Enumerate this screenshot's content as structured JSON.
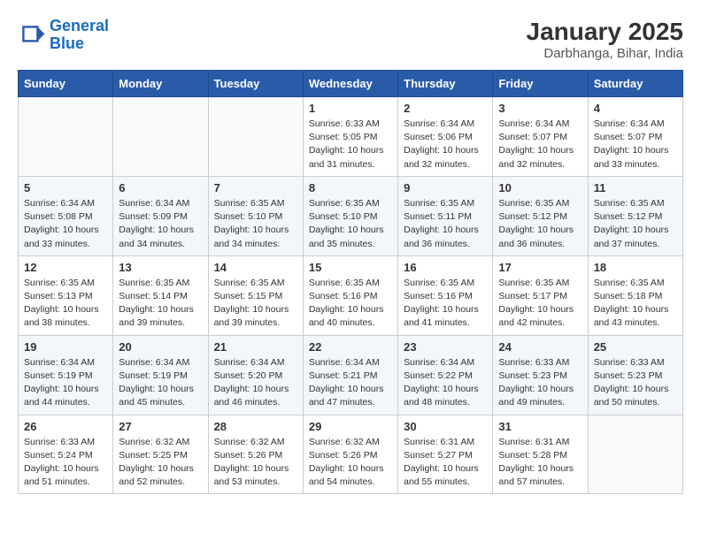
{
  "header": {
    "logo_line1": "General",
    "logo_line2": "Blue",
    "month": "January 2025",
    "location": "Darbhanga, Bihar, India"
  },
  "weekdays": [
    "Sunday",
    "Monday",
    "Tuesday",
    "Wednesday",
    "Thursday",
    "Friday",
    "Saturday"
  ],
  "weeks": [
    [
      {
        "day": "",
        "info": ""
      },
      {
        "day": "",
        "info": ""
      },
      {
        "day": "",
        "info": ""
      },
      {
        "day": "1",
        "info": "Sunrise: 6:33 AM\nSunset: 5:05 PM\nDaylight: 10 hours\nand 31 minutes."
      },
      {
        "day": "2",
        "info": "Sunrise: 6:34 AM\nSunset: 5:06 PM\nDaylight: 10 hours\nand 32 minutes."
      },
      {
        "day": "3",
        "info": "Sunrise: 6:34 AM\nSunset: 5:07 PM\nDaylight: 10 hours\nand 32 minutes."
      },
      {
        "day": "4",
        "info": "Sunrise: 6:34 AM\nSunset: 5:07 PM\nDaylight: 10 hours\nand 33 minutes."
      }
    ],
    [
      {
        "day": "5",
        "info": "Sunrise: 6:34 AM\nSunset: 5:08 PM\nDaylight: 10 hours\nand 33 minutes."
      },
      {
        "day": "6",
        "info": "Sunrise: 6:34 AM\nSunset: 5:09 PM\nDaylight: 10 hours\nand 34 minutes."
      },
      {
        "day": "7",
        "info": "Sunrise: 6:35 AM\nSunset: 5:10 PM\nDaylight: 10 hours\nand 34 minutes."
      },
      {
        "day": "8",
        "info": "Sunrise: 6:35 AM\nSunset: 5:10 PM\nDaylight: 10 hours\nand 35 minutes."
      },
      {
        "day": "9",
        "info": "Sunrise: 6:35 AM\nSunset: 5:11 PM\nDaylight: 10 hours\nand 36 minutes."
      },
      {
        "day": "10",
        "info": "Sunrise: 6:35 AM\nSunset: 5:12 PM\nDaylight: 10 hours\nand 36 minutes."
      },
      {
        "day": "11",
        "info": "Sunrise: 6:35 AM\nSunset: 5:12 PM\nDaylight: 10 hours\nand 37 minutes."
      }
    ],
    [
      {
        "day": "12",
        "info": "Sunrise: 6:35 AM\nSunset: 5:13 PM\nDaylight: 10 hours\nand 38 minutes."
      },
      {
        "day": "13",
        "info": "Sunrise: 6:35 AM\nSunset: 5:14 PM\nDaylight: 10 hours\nand 39 minutes."
      },
      {
        "day": "14",
        "info": "Sunrise: 6:35 AM\nSunset: 5:15 PM\nDaylight: 10 hours\nand 39 minutes."
      },
      {
        "day": "15",
        "info": "Sunrise: 6:35 AM\nSunset: 5:16 PM\nDaylight: 10 hours\nand 40 minutes."
      },
      {
        "day": "16",
        "info": "Sunrise: 6:35 AM\nSunset: 5:16 PM\nDaylight: 10 hours\nand 41 minutes."
      },
      {
        "day": "17",
        "info": "Sunrise: 6:35 AM\nSunset: 5:17 PM\nDaylight: 10 hours\nand 42 minutes."
      },
      {
        "day": "18",
        "info": "Sunrise: 6:35 AM\nSunset: 5:18 PM\nDaylight: 10 hours\nand 43 minutes."
      }
    ],
    [
      {
        "day": "19",
        "info": "Sunrise: 6:34 AM\nSunset: 5:19 PM\nDaylight: 10 hours\nand 44 minutes."
      },
      {
        "day": "20",
        "info": "Sunrise: 6:34 AM\nSunset: 5:19 PM\nDaylight: 10 hours\nand 45 minutes."
      },
      {
        "day": "21",
        "info": "Sunrise: 6:34 AM\nSunset: 5:20 PM\nDaylight: 10 hours\nand 46 minutes."
      },
      {
        "day": "22",
        "info": "Sunrise: 6:34 AM\nSunset: 5:21 PM\nDaylight: 10 hours\nand 47 minutes."
      },
      {
        "day": "23",
        "info": "Sunrise: 6:34 AM\nSunset: 5:22 PM\nDaylight: 10 hours\nand 48 minutes."
      },
      {
        "day": "24",
        "info": "Sunrise: 6:33 AM\nSunset: 5:23 PM\nDaylight: 10 hours\nand 49 minutes."
      },
      {
        "day": "25",
        "info": "Sunrise: 6:33 AM\nSunset: 5:23 PM\nDaylight: 10 hours\nand 50 minutes."
      }
    ],
    [
      {
        "day": "26",
        "info": "Sunrise: 6:33 AM\nSunset: 5:24 PM\nDaylight: 10 hours\nand 51 minutes."
      },
      {
        "day": "27",
        "info": "Sunrise: 6:32 AM\nSunset: 5:25 PM\nDaylight: 10 hours\nand 52 minutes."
      },
      {
        "day": "28",
        "info": "Sunrise: 6:32 AM\nSunset: 5:26 PM\nDaylight: 10 hours\nand 53 minutes."
      },
      {
        "day": "29",
        "info": "Sunrise: 6:32 AM\nSunset: 5:26 PM\nDaylight: 10 hours\nand 54 minutes."
      },
      {
        "day": "30",
        "info": "Sunrise: 6:31 AM\nSunset: 5:27 PM\nDaylight: 10 hours\nand 55 minutes."
      },
      {
        "day": "31",
        "info": "Sunrise: 6:31 AM\nSunset: 5:28 PM\nDaylight: 10 hours\nand 57 minutes."
      },
      {
        "day": "",
        "info": ""
      }
    ]
  ]
}
